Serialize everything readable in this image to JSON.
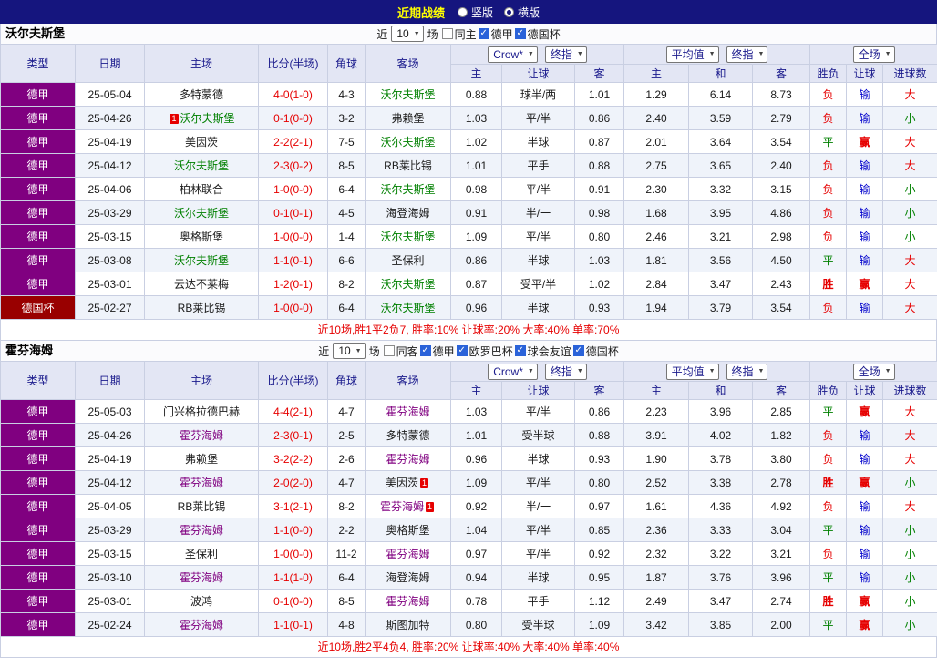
{
  "colors": {
    "topbar_bg": "#15157E",
    "title_yellow": "#FFFF00",
    "header_bg": "#E3E6F4",
    "header_text": "#1A1A8C",
    "league_purple": "#800080",
    "cup_red": "#990000",
    "row_alt": "#EFF3FA",
    "grid": "#C9CFE2",
    "score_red": "#E60000",
    "win_red": "#E60000",
    "draw_green": "#008000",
    "lose_blue": "#0000CC",
    "summary_red": "#E60000",
    "checkbox_blue": "#2A62D9"
  },
  "topbar": {
    "title": "近期战绩",
    "radios": [
      {
        "label": "竖版",
        "checked": false
      },
      {
        "label": "横版",
        "checked": true
      }
    ]
  },
  "header": {
    "type": "类型",
    "date": "日期",
    "home": "主场",
    "score": "比分(半场)",
    "corner": "角球",
    "away": "客场",
    "dd_company": "Crow*",
    "dd_final": "终指",
    "dd_avg": "平均值",
    "dd_final2": "终指",
    "dd_scope": "全场",
    "sub_home": "主",
    "sub_handicap": "让球",
    "sub_away": "客",
    "sub_home2": "主",
    "sub_draw": "和",
    "sub_away2": "客",
    "sub_result": "胜负",
    "sub_handicap_result": "让球",
    "sub_goals": "进球数"
  },
  "sections": [
    {
      "team": "沃尔夫斯堡",
      "team_color": "#008000",
      "filters": {
        "near": "近",
        "count": "10",
        "games": "场",
        "checkboxes": [
          {
            "label": "同主",
            "checked": false
          },
          {
            "label": "德甲",
            "checked": true
          },
          {
            "label": "德国杯",
            "checked": true
          }
        ]
      },
      "rows": [
        {
          "type": "德甲",
          "date": "25-05-04",
          "home": "多特蒙德",
          "score": "4-0(1-0)",
          "corner": "4-3",
          "away": "沃尔夫斯堡",
          "odds_home": "0.88",
          "handicap": "球半/两",
          "odds_away": "1.01",
          "avg_home": "1.29",
          "avg_draw": "6.14",
          "avg_away": "8.73",
          "result": "负",
          "handicap_result": "输",
          "goals": "大"
        },
        {
          "type": "德甲",
          "date": "25-04-26",
          "home": "沃尔夫斯堡",
          "home_card": "1",
          "home_card_side": "left",
          "score": "0-1(0-0)",
          "corner": "3-2",
          "away": "弗赖堡",
          "odds_home": "1.03",
          "handicap": "平/半",
          "odds_away": "0.86",
          "avg_home": "2.40",
          "avg_draw": "3.59",
          "avg_away": "2.79",
          "result": "负",
          "handicap_result": "输",
          "goals": "小"
        },
        {
          "type": "德甲",
          "date": "25-04-19",
          "home": "美因茨",
          "score": "2-2(2-1)",
          "corner": "7-5",
          "away": "沃尔夫斯堡",
          "odds_home": "1.02",
          "handicap": "半球",
          "odds_away": "0.87",
          "avg_home": "2.01",
          "avg_draw": "3.64",
          "avg_away": "3.54",
          "result": "平",
          "handicap_result": "赢",
          "goals": "大"
        },
        {
          "type": "德甲",
          "date": "25-04-12",
          "home": "沃尔夫斯堡",
          "score": "2-3(0-2)",
          "corner": "8-5",
          "away": "RB莱比锡",
          "odds_home": "1.01",
          "handicap": "平手",
          "odds_away": "0.88",
          "avg_home": "2.75",
          "avg_draw": "3.65",
          "avg_away": "2.40",
          "result": "负",
          "handicap_result": "输",
          "goals": "大"
        },
        {
          "type": "德甲",
          "date": "25-04-06",
          "home": "柏林联合",
          "score": "1-0(0-0)",
          "corner": "6-4",
          "away": "沃尔夫斯堡",
          "odds_home": "0.98",
          "handicap": "平/半",
          "odds_away": "0.91",
          "avg_home": "2.30",
          "avg_draw": "3.32",
          "avg_away": "3.15",
          "result": "负",
          "handicap_result": "输",
          "goals": "小"
        },
        {
          "type": "德甲",
          "date": "25-03-29",
          "home": "沃尔夫斯堡",
          "score": "0-1(0-1)",
          "corner": "4-5",
          "away": "海登海姆",
          "odds_home": "0.91",
          "handicap": "半/一",
          "odds_away": "0.98",
          "avg_home": "1.68",
          "avg_draw": "3.95",
          "avg_away": "4.86",
          "result": "负",
          "handicap_result": "输",
          "goals": "小"
        },
        {
          "type": "德甲",
          "date": "25-03-15",
          "home": "奥格斯堡",
          "score": "1-0(0-0)",
          "corner": "1-4",
          "away": "沃尔夫斯堡",
          "odds_home": "1.09",
          "handicap": "平/半",
          "odds_away": "0.80",
          "avg_home": "2.46",
          "avg_draw": "3.21",
          "avg_away": "2.98",
          "result": "负",
          "handicap_result": "输",
          "goals": "小"
        },
        {
          "type": "德甲",
          "date": "25-03-08",
          "home": "沃尔夫斯堡",
          "score": "1-1(0-1)",
          "corner": "6-6",
          "away": "圣保利",
          "odds_home": "0.86",
          "handicap": "半球",
          "odds_away": "1.03",
          "avg_home": "1.81",
          "avg_draw": "3.56",
          "avg_away": "4.50",
          "result": "平",
          "handicap_result": "输",
          "goals": "大"
        },
        {
          "type": "德甲",
          "date": "25-03-01",
          "home": "云达不莱梅",
          "score": "1-2(0-1)",
          "corner": "8-2",
          "away": "沃尔夫斯堡",
          "odds_home": "0.87",
          "handicap": "受平/半",
          "odds_away": "1.02",
          "avg_home": "2.84",
          "avg_draw": "3.47",
          "avg_away": "2.43",
          "result": "胜",
          "handicap_result": "赢",
          "goals": "大"
        },
        {
          "type": "德国杯",
          "date": "25-02-27",
          "home": "RB莱比锡",
          "score": "1-0(0-0)",
          "corner": "6-4",
          "away": "沃尔夫斯堡",
          "odds_home": "0.96",
          "handicap": "半球",
          "odds_away": "0.93",
          "avg_home": "1.94",
          "avg_draw": "3.79",
          "avg_away": "3.54",
          "result": "负",
          "handicap_result": "输",
          "goals": "大"
        }
      ],
      "summary": "近10场,胜1平2负7, 胜率:10%  让球率:20%  大率:40%  单率:70%"
    },
    {
      "team": "霍芬海姆",
      "team_color": "#800080",
      "filters": {
        "near": "近",
        "count": "10",
        "games": "场",
        "checkboxes": [
          {
            "label": "同客",
            "checked": false
          },
          {
            "label": "德甲",
            "checked": true
          },
          {
            "label": "欧罗巴杯",
            "checked": true
          },
          {
            "label": "球会友谊",
            "checked": true
          },
          {
            "label": "德国杯",
            "checked": true
          }
        ]
      },
      "rows": [
        {
          "type": "德甲",
          "date": "25-05-03",
          "home": "门兴格拉德巴赫",
          "score": "4-4(2-1)",
          "corner": "4-7",
          "away": "霍芬海姆",
          "odds_home": "1.03",
          "handicap": "平/半",
          "odds_away": "0.86",
          "avg_home": "2.23",
          "avg_draw": "3.96",
          "avg_away": "2.85",
          "result": "平",
          "handicap_result": "赢",
          "goals": "大"
        },
        {
          "type": "德甲",
          "date": "25-04-26",
          "home": "霍芬海姆",
          "score": "2-3(0-1)",
          "corner": "2-5",
          "away": "多特蒙德",
          "odds_home": "1.01",
          "handicap": "受半球",
          "odds_away": "0.88",
          "avg_home": "3.91",
          "avg_draw": "4.02",
          "avg_away": "1.82",
          "result": "负",
          "handicap_result": "输",
          "goals": "大"
        },
        {
          "type": "德甲",
          "date": "25-04-19",
          "home": "弗赖堡",
          "score": "3-2(2-2)",
          "corner": "2-6",
          "away": "霍芬海姆",
          "odds_home": "0.96",
          "handicap": "半球",
          "odds_away": "0.93",
          "avg_home": "1.90",
          "avg_draw": "3.78",
          "avg_away": "3.80",
          "result": "负",
          "handicap_result": "输",
          "goals": "大"
        },
        {
          "type": "德甲",
          "date": "25-04-12",
          "home": "霍芬海姆",
          "score": "2-0(2-0)",
          "corner": "4-7",
          "away": "美因茨",
          "away_card": "1",
          "away_card_side": "right",
          "odds_home": "1.09",
          "handicap": "平/半",
          "odds_away": "0.80",
          "avg_home": "2.52",
          "avg_draw": "3.38",
          "avg_away": "2.78",
          "result": "胜",
          "handicap_result": "赢",
          "goals": "小"
        },
        {
          "type": "德甲",
          "date": "25-04-05",
          "home": "RB莱比锡",
          "score": "3-1(2-1)",
          "corner": "8-2",
          "away": "霍芬海姆",
          "away_card": "1",
          "away_card_side": "right",
          "odds_home": "0.92",
          "handicap": "半/一",
          "odds_away": "0.97",
          "avg_home": "1.61",
          "avg_draw": "4.36",
          "avg_away": "4.92",
          "result": "负",
          "handicap_result": "输",
          "goals": "大"
        },
        {
          "type": "德甲",
          "date": "25-03-29",
          "home": "霍芬海姆",
          "score": "1-1(0-0)",
          "corner": "2-2",
          "away": "奥格斯堡",
          "odds_home": "1.04",
          "handicap": "平/半",
          "odds_away": "0.85",
          "avg_home": "2.36",
          "avg_draw": "3.33",
          "avg_away": "3.04",
          "result": "平",
          "handicap_result": "输",
          "goals": "小"
        },
        {
          "type": "德甲",
          "date": "25-03-15",
          "home": "圣保利",
          "score": "1-0(0-0)",
          "corner": "11-2",
          "away": "霍芬海姆",
          "odds_home": "0.97",
          "handicap": "平/半",
          "odds_away": "0.92",
          "avg_home": "2.32",
          "avg_draw": "3.22",
          "avg_away": "3.21",
          "result": "负",
          "handicap_result": "输",
          "goals": "小"
        },
        {
          "type": "德甲",
          "date": "25-03-10",
          "home": "霍芬海姆",
          "score": "1-1(1-0)",
          "corner": "6-4",
          "away": "海登海姆",
          "odds_home": "0.94",
          "handicap": "半球",
          "odds_away": "0.95",
          "avg_home": "1.87",
          "avg_draw": "3.76",
          "avg_away": "3.96",
          "result": "平",
          "handicap_result": "输",
          "goals": "小"
        },
        {
          "type": "德甲",
          "date": "25-03-01",
          "home": "波鸿",
          "score": "0-1(0-0)",
          "corner": "8-5",
          "away": "霍芬海姆",
          "odds_home": "0.78",
          "handicap": "平手",
          "odds_away": "1.12",
          "avg_home": "2.49",
          "avg_draw": "3.47",
          "avg_away": "2.74",
          "result": "胜",
          "handicap_result": "赢",
          "goals": "小"
        },
        {
          "type": "德甲",
          "date": "25-02-24",
          "home": "霍芬海姆",
          "score": "1-1(0-1)",
          "corner": "4-8",
          "away": "斯图加特",
          "odds_home": "0.80",
          "handicap": "受半球",
          "odds_away": "1.09",
          "avg_home": "3.42",
          "avg_draw": "3.85",
          "avg_away": "2.00",
          "result": "平",
          "handicap_result": "赢",
          "goals": "小"
        }
      ],
      "summary": "近10场,胜2平4负4, 胜率:20%  让球率:40%  大率:40%  单率:40%"
    }
  ]
}
